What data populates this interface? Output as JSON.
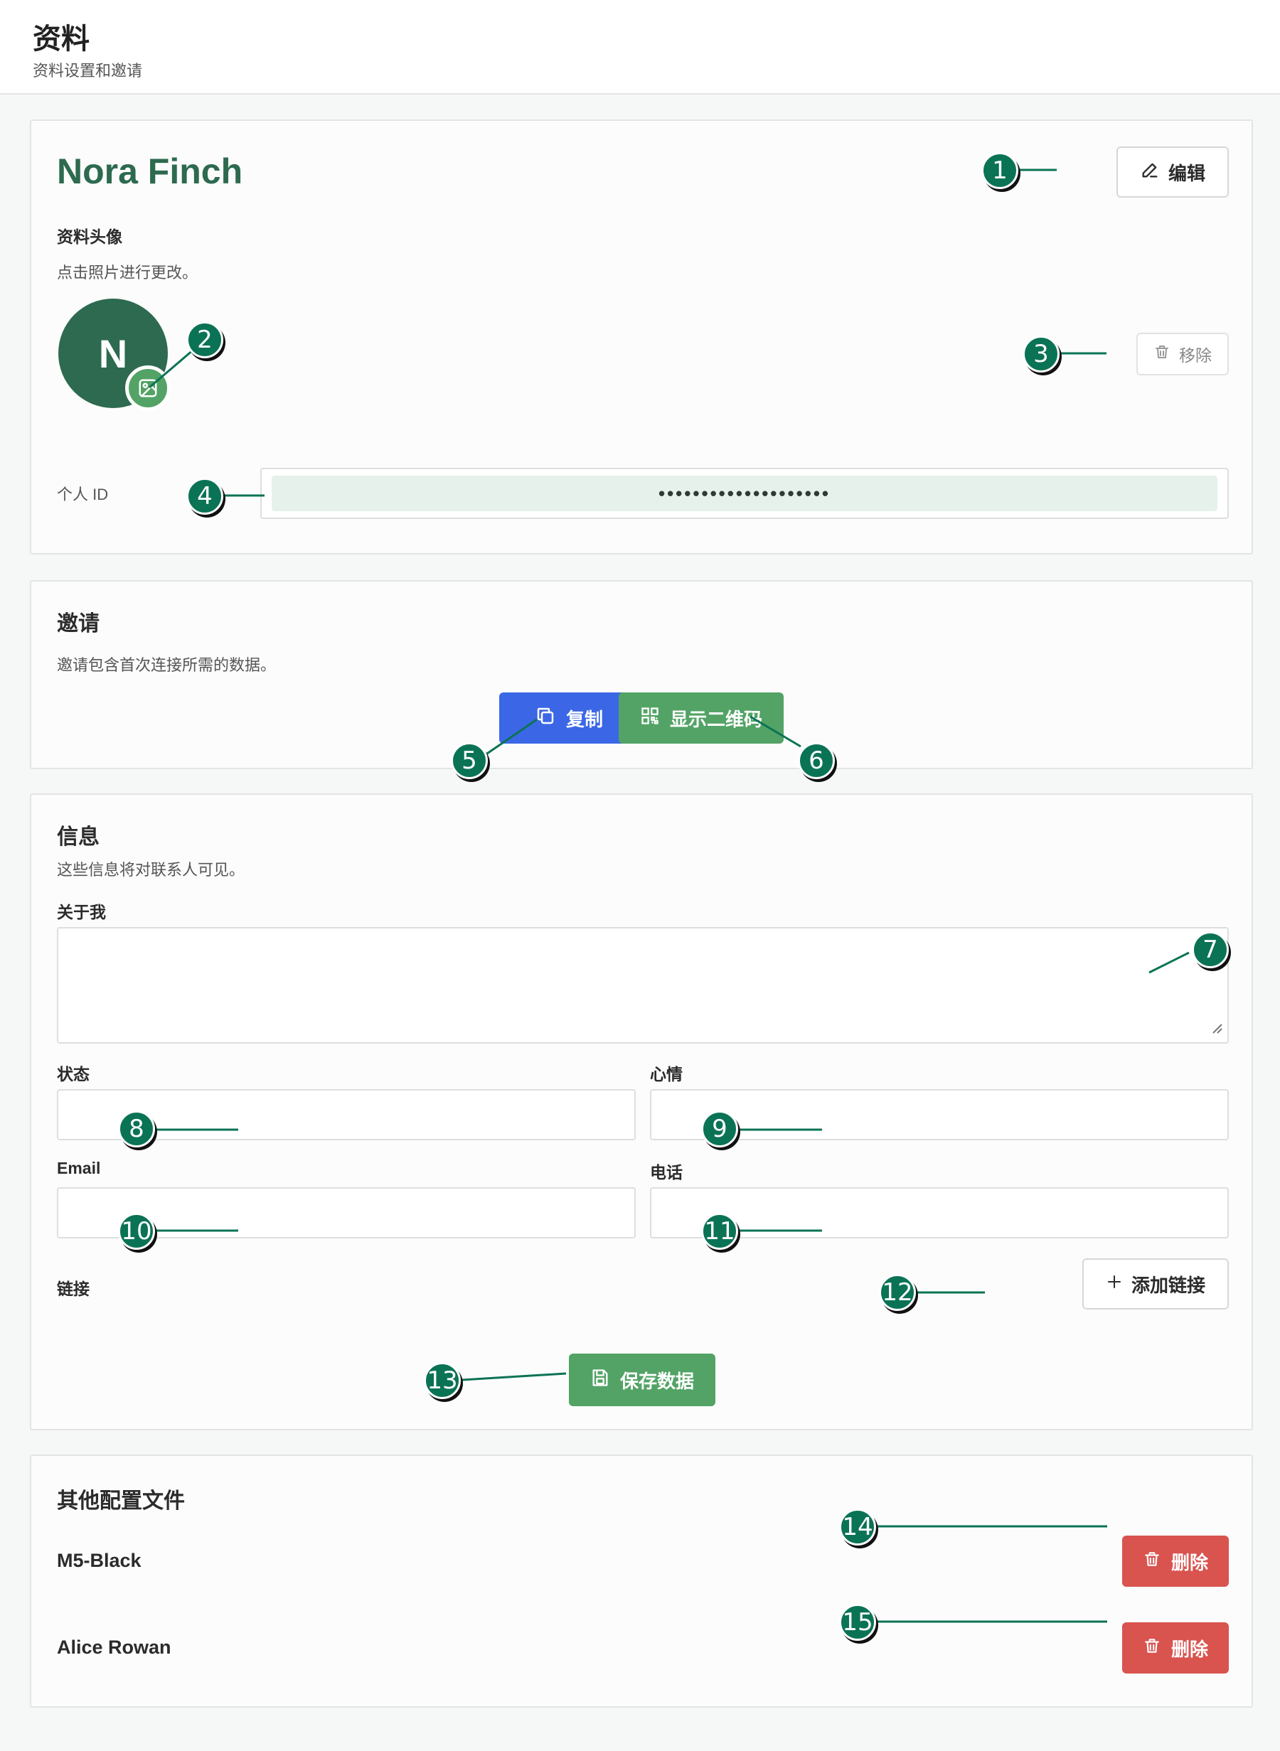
{
  "header": {
    "title": "资料",
    "subtitle": "资料设置和邀请"
  },
  "profile": {
    "name": "Nora Finch",
    "edit_label": "编辑",
    "avatar_heading": "资料头像",
    "avatar_hint": "点击照片进行更改。",
    "avatar_initial": "N",
    "remove_label": "移除",
    "id_label": "个人 ID",
    "id_value": "••••••••••••••••••••"
  },
  "invite": {
    "heading": "邀请",
    "description": "邀请包含首次连接所需的数据。",
    "copy_label": "复制",
    "qr_label": "显示二维码"
  },
  "info": {
    "heading": "信息",
    "description": "这些信息将对联系人可见。",
    "about_label": "关于我",
    "about_value": "",
    "status_label": "状态",
    "status_value": "",
    "mood_label": "心情",
    "mood_value": "",
    "email_label": "Email",
    "email_value": "",
    "phone_label": "电话",
    "phone_value": "",
    "links_label": "链接",
    "add_link_label": "添加链接",
    "save_label": "保存数据"
  },
  "other_profiles": {
    "heading": "其他配置文件",
    "delete_label": "删除",
    "items": [
      {
        "name": "M5-Black"
      },
      {
        "name": "Alice Rowan"
      }
    ]
  },
  "markers": [
    "1",
    "2",
    "3",
    "4",
    "5",
    "6",
    "7",
    "8",
    "9",
    "10",
    "11",
    "12",
    "13",
    "14",
    "15"
  ],
  "colors": {
    "accent_green": "#2d6a4f",
    "button_green": "#52a365",
    "button_blue": "#3b67e6",
    "button_red": "#d9534f",
    "marker": "#0b7355"
  }
}
